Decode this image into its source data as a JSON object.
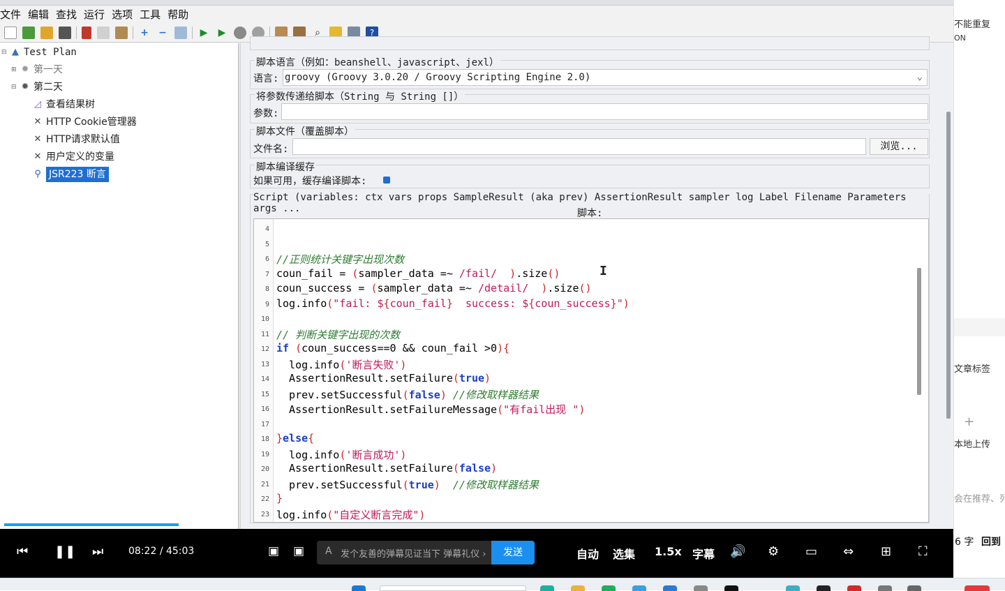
{
  "menubar": {
    "items": [
      "文件",
      "编辑",
      "查找",
      "运行",
      "选项",
      "工具",
      "帮助"
    ]
  },
  "tree": {
    "root": "Test Plan",
    "day1": "第一天",
    "day2": "第二天",
    "children": [
      "查看结果树",
      "HTTP Cookie管理器",
      "HTTP请求默认值",
      "用户定义的变量",
      "JSR223 断言"
    ]
  },
  "panel": {
    "script_lang_title": "脚本语言（例如：beanshell、javascript、jexl）",
    "lang_label": "语言:",
    "lang_value": "groovy     (Groovy 3.0.20 / Groovy Scripting Engine 2.0)",
    "params_title": "将参数传递给脚本（String 与 String []）",
    "params_label": "参数:",
    "params_value": "",
    "file_title": "脚本文件（覆盖脚本）",
    "file_label": "文件名:",
    "file_value": "",
    "browse_label": "浏览...",
    "cache_title": "脚本编译缓存",
    "cache_label": "如果可用，缓存编译脚本:",
    "cache_checked": true,
    "script_vars": "Script (variables: ctx vars props SampleResult (aka prev) AssertionResult sampler log Label Filename Parameters args ...",
    "script_label": "脚本:"
  },
  "editor": {
    "line_numbers": [
      "4",
      "5",
      "6",
      "7",
      "8",
      "9",
      "10",
      "11",
      "12",
      "13",
      "14",
      "15",
      "16",
      "17",
      "18",
      "19",
      "20",
      "21",
      "22",
      "23"
    ],
    "lines": [
      "",
      "",
      "//正则统计关键字出现次数",
      "coun_fail = (sampler_data =~ /fail/  ).size()",
      "coun_success = (sampler_data =~ /detail/  ).size()",
      "log.info(\"fail: ${coun_fail}  success: ${coun_success}\")",
      "",
      "// 判断关键字出现的次数",
      "if (coun_success==0 && coun_fail >0){",
      "  log.info('断言失败')",
      "  AssertionResult.setFailure(true)",
      "  prev.setSuccessful(false) //修改取样器结果",
      "  AssertionResult.setFailureMessage(\"有fail出现 \")",
      "",
      "}else{",
      "  log.info('断言成功')",
      "  AssertionResult.setFailure(false)",
      "  prev.setSuccessful(true)  //修改取样器结果",
      "}",
      "log.info(\"自定义断言完成\")"
    ]
  },
  "side": {
    "items": [
      "不能重复",
      "ON",
      "文章标签",
      "本地上传",
      "会在推荐、列",
      "6 字",
      "回到"
    ]
  },
  "player": {
    "time_current": "08:22",
    "time_separator": "/",
    "time_total": "45:03",
    "danmu_placeholder": "发个友善的弹幕见证当下",
    "danmu_etiquette": "弹幕礼仪 ›",
    "send_label": "发送",
    "auto_label": "自动",
    "episodes_label": "选集",
    "speed_label": "1.5x",
    "subtitle_label": "字幕"
  },
  "colors": {
    "selection": "#1f6fd1",
    "comment": "#2e7d32",
    "keyword": "#1a3ec4",
    "string": "#c2185b",
    "send": "#1b8ff0"
  }
}
